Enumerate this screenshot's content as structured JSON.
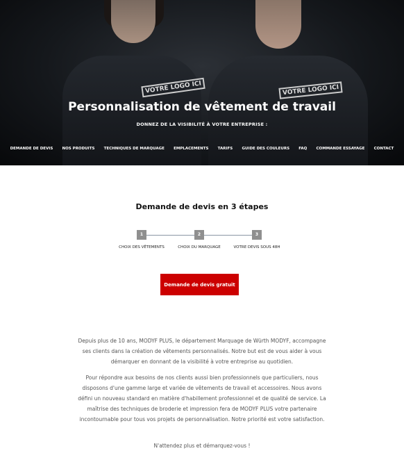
{
  "hero": {
    "title": "Personnalisation de vêtement de travail",
    "subtitle": "DONNEZ DE LA VISIBILITÉ À VOTRE ENTREPRISE :",
    "badge_text": "VOTRE LOGO ICI"
  },
  "nav": {
    "items": [
      "DEMANDE DE DEVIS",
      "NOS PRODUITS",
      "TECHNIQUES DE MARQUAGE",
      "EMPLACEMENTS",
      "TARIFS",
      "GUIDE DES COULEURS",
      "FAQ",
      "COMMANDE ESSAYAGE",
      "CONTACT"
    ]
  },
  "steps": {
    "title": "Demande de devis en 3 étapes",
    "items": [
      {
        "number": "1",
        "label": "CHOIX DES VÊTEMENTS"
      },
      {
        "number": "2",
        "label": "CHOIX DU MARQUAGE"
      },
      {
        "number": "3",
        "label": "VOTRE DEVIS SOUS 48H"
      }
    ]
  },
  "cta": {
    "label": "Demande de devis gratuit",
    "color": "#cc0000"
  },
  "content": {
    "paragraph1": "Depuis plus de 10 ans, MODYF PLUS, le département Marquage de Würth MODYF, accompagne ses clients dans la création de vêtements personnalisés. Notre but est de vous aider à vous démarquer en donnant de la visibilité à votre entreprise au quotidien.",
    "paragraph2": "Pour répondre aux besoins de nos clients aussi bien professionnels que particuliers, nous disposons d'une gamme large et variée de vêtements de travail et accessoires. Nous avons défini un nouveau standard en matière d'habillement professionnel et de qualité de service. La maîtrise des techniques de broderie et impression fera de MODYF PLUS votre partenaire incontournable pour tous vos projets de personnalisation. Notre priorité est votre satisfaction.",
    "paragraph3": "N'attendez plus et démarquez-vous !"
  }
}
